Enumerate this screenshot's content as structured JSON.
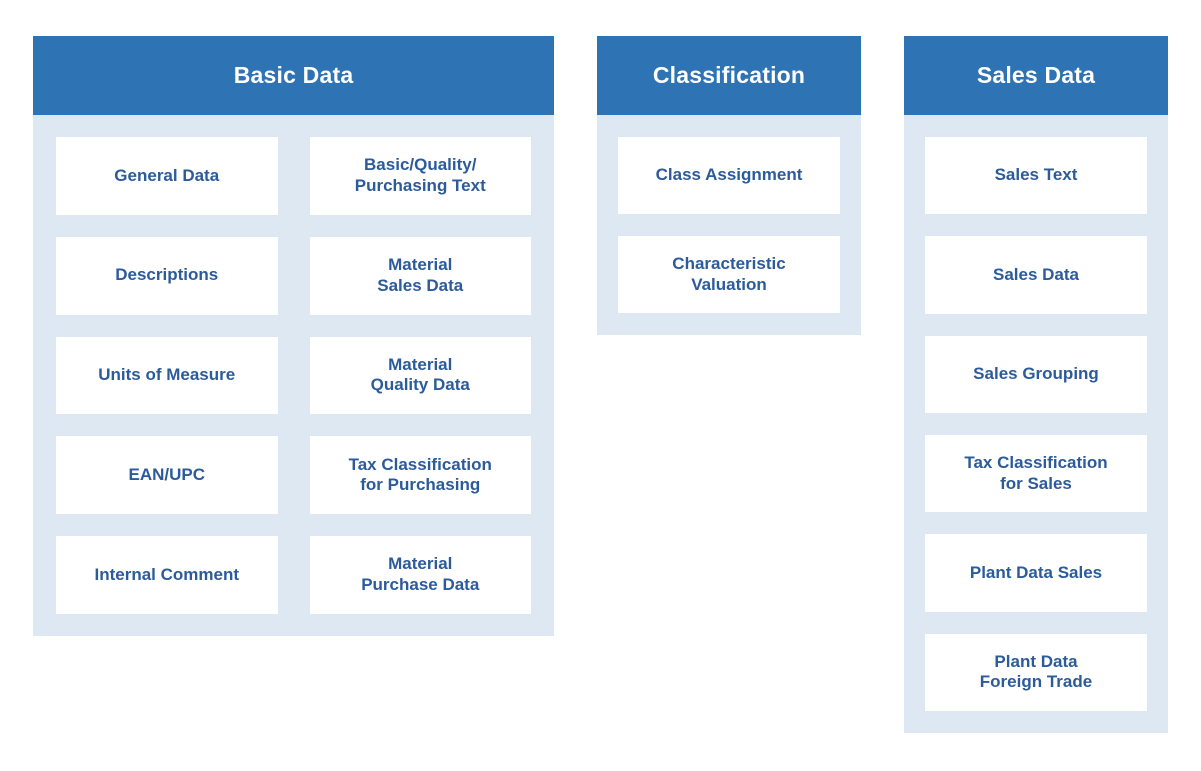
{
  "page": {
    "background_color": "#ffffff",
    "header_color": "#2e73b4",
    "panel_background_color": "#dde8f3",
    "card_background_color": "#ffffff",
    "card_text_color": "#2c5b9b",
    "header_text_color": "#ffffff"
  },
  "panels": [
    {
      "id": "basic-data",
      "title": "Basic Data",
      "columns": [
        {
          "items": [
            {
              "label": "General Data"
            },
            {
              "label": "Descriptions"
            },
            {
              "label": "Units of Measure"
            },
            {
              "label": "EAN/UPC"
            },
            {
              "label": "Internal Comment"
            }
          ]
        },
        {
          "items": [
            {
              "label": "Basic/Quality/\nPurchasing Text"
            },
            {
              "label": "Material\nSales Data"
            },
            {
              "label": "Material\nQuality Data"
            },
            {
              "label": "Tax Classification\nfor Purchasing"
            },
            {
              "label": "Material\nPurchase Data"
            }
          ]
        }
      ]
    },
    {
      "id": "classification",
      "title": "Classification",
      "columns": [
        {
          "items": [
            {
              "label": "Class Assignment"
            },
            {
              "label": "Characteristic\nValuation"
            }
          ]
        }
      ]
    },
    {
      "id": "sales-data",
      "title": "Sales Data",
      "columns": [
        {
          "items": [
            {
              "label": "Sales Text"
            },
            {
              "label": "Sales Data"
            },
            {
              "label": "Sales Grouping"
            },
            {
              "label": "Tax Classification\nfor Sales"
            },
            {
              "label": "Plant Data Sales"
            },
            {
              "label": "Plant Data\nForeign Trade"
            }
          ]
        }
      ]
    }
  ]
}
